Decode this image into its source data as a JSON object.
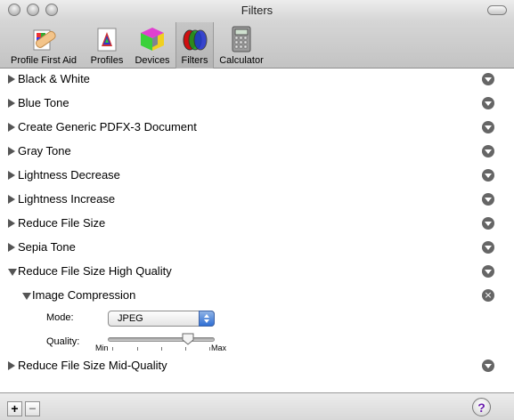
{
  "window": {
    "title": "Filters"
  },
  "toolbar": {
    "items": [
      {
        "label": "Profile First Aid",
        "icon": "profile-first-aid-icon"
      },
      {
        "label": "Profiles",
        "icon": "profiles-icon"
      },
      {
        "label": "Devices",
        "icon": "devices-icon"
      },
      {
        "label": "Filters",
        "icon": "filters-icon",
        "selected": true
      },
      {
        "label": "Calculator",
        "icon": "calculator-icon"
      }
    ]
  },
  "filters": {
    "items": [
      {
        "label": "Black & White",
        "expanded": false
      },
      {
        "label": "Blue Tone",
        "expanded": false
      },
      {
        "label": "Create Generic PDFX-3 Document",
        "expanded": false
      },
      {
        "label": "Gray Tone",
        "expanded": false
      },
      {
        "label": "Lightness Decrease",
        "expanded": false
      },
      {
        "label": "Lightness Increase",
        "expanded": false
      },
      {
        "label": "Reduce File Size",
        "expanded": false
      },
      {
        "label": "Sepia Tone",
        "expanded": false
      },
      {
        "label": "Reduce File Size High Quality",
        "expanded": true
      },
      {
        "label": "Reduce File Size Mid-Quality",
        "expanded": false
      }
    ],
    "subitem": {
      "label": "Image Compression",
      "mode_label": "Mode:",
      "mode_value": "JPEG",
      "quality_label": "Quality:",
      "quality_min": "Min",
      "quality_max": "Max",
      "quality_fraction": 0.75
    }
  },
  "bottombar": {
    "add_label": "+",
    "remove_label": "−",
    "help_label": "?"
  }
}
